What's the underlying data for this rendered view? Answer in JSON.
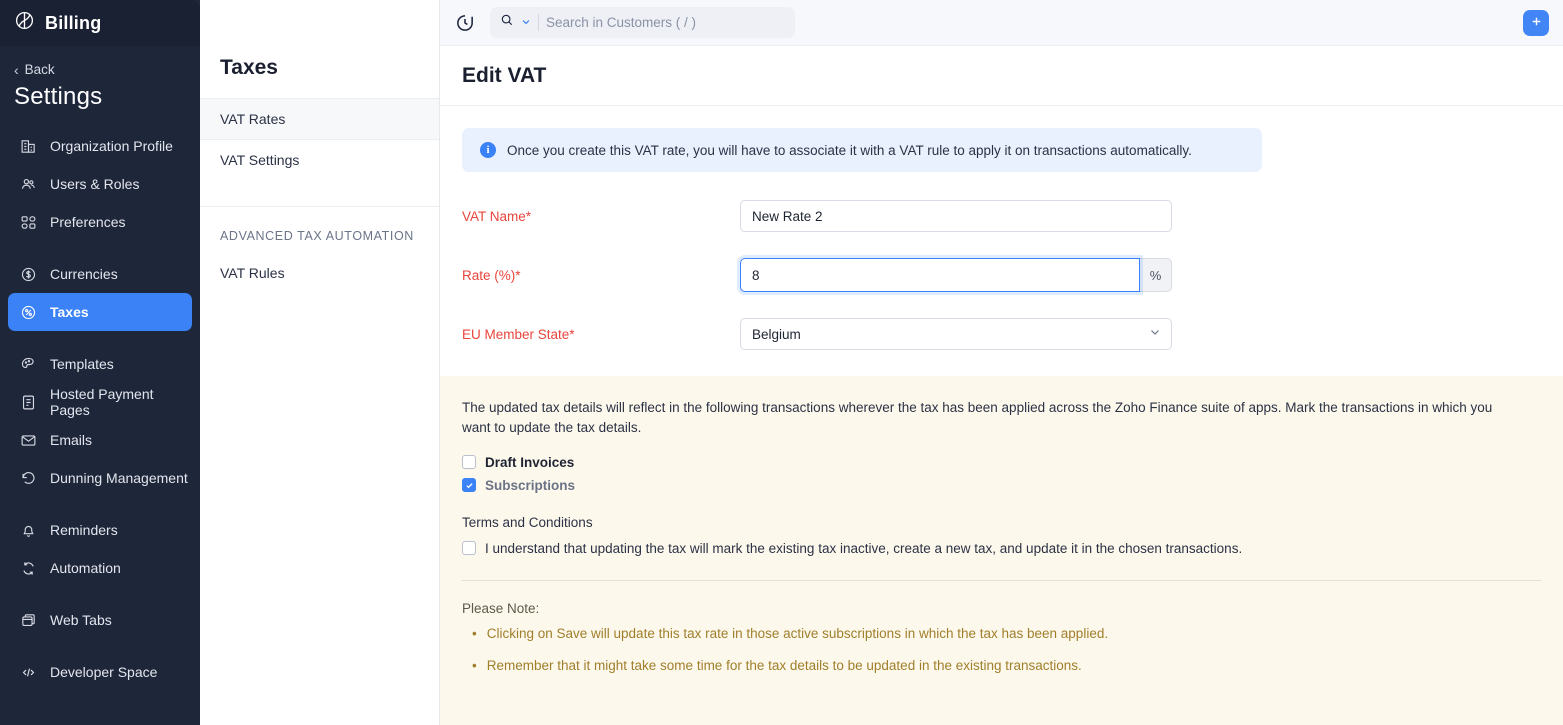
{
  "sidebar": {
    "brand": "Billing",
    "back_label": "Back",
    "title": "Settings",
    "items": [
      {
        "label": "Organization Profile",
        "icon": "building-icon",
        "active": false
      },
      {
        "label": "Users & Roles",
        "icon": "users-icon",
        "active": false
      },
      {
        "label": "Preferences",
        "icon": "preferences-icon",
        "active": false
      },
      {
        "label": "Currencies",
        "icon": "currency-icon",
        "active": false
      },
      {
        "label": "Taxes",
        "icon": "percent-icon",
        "active": true
      },
      {
        "label": "Templates",
        "icon": "templates-icon",
        "active": false
      },
      {
        "label": "Hosted Payment Pages",
        "icon": "page-icon",
        "active": false
      },
      {
        "label": "Emails",
        "icon": "mail-icon",
        "active": false
      },
      {
        "label": "Dunning Management",
        "icon": "refresh-back-icon",
        "active": false
      },
      {
        "label": "Reminders",
        "icon": "bell-icon",
        "active": false
      },
      {
        "label": "Automation",
        "icon": "automation-icon",
        "active": false
      },
      {
        "label": "Web Tabs",
        "icon": "webtabs-icon",
        "active": false
      },
      {
        "label": "Developer Space",
        "icon": "code-icon",
        "active": false
      }
    ]
  },
  "subpanel": {
    "title": "Taxes",
    "items": [
      {
        "label": "VAT Rates",
        "active": true
      },
      {
        "label": "VAT Settings",
        "active": false
      }
    ],
    "section_label": "ADVANCED TAX AUTOMATION",
    "section_items": [
      {
        "label": "VAT Rules",
        "active": false
      }
    ]
  },
  "topbar": {
    "history_icon": "history-icon",
    "search_icon": "search-icon",
    "search_chevron_icon": "chevron-down-icon",
    "search_placeholder": "Search in Customers ( / )",
    "search_value": "",
    "add_icon": "plus-icon"
  },
  "page": {
    "title": "Edit VAT",
    "info_banner": {
      "icon": "info-icon",
      "text": "Once you create this VAT rate, you will have to associate it with a VAT rule to apply it on transactions automatically."
    },
    "fields": {
      "vat_name": {
        "label": "VAT Name*",
        "value": "New Rate 2",
        "placeholder": ""
      },
      "rate": {
        "label": "Rate (%)*",
        "value": "8",
        "suffix": "%",
        "placeholder": ""
      },
      "eu_member_state": {
        "label": "EU Member State*",
        "value": "Belgium",
        "chevron_icon": "chevron-down-icon"
      }
    }
  },
  "notice": {
    "paragraph": "The updated tax details will reflect in the following transactions wherever the tax has been applied across the Zoho Finance suite of apps. Mark the transactions in which you want to update the tax details.",
    "checkboxes": [
      {
        "label": "Draft Invoices",
        "checked": false
      },
      {
        "label": "Subscriptions",
        "checked": true
      }
    ],
    "terms_heading": "Terms and Conditions",
    "terms_checkbox": {
      "label": "I understand that updating the tax will mark the existing tax inactive, create a new tax, and update it in the chosen transactions.",
      "checked": false
    },
    "note_heading": "Please Note:",
    "notes": [
      "Clicking on Save will update this tax rate in those active subscriptions in which the tax has been applied.",
      "Remember that it might take some time for the tax details to be updated in the existing transactions."
    ]
  },
  "colors": {
    "sidebar_bg": "#1e2639",
    "accent_blue": "#3b82f6",
    "required_red": "#e8453c",
    "notice_bg": "#fdf8ec",
    "note_text": "#a07f2b",
    "info_bg": "#e9f0fe"
  }
}
